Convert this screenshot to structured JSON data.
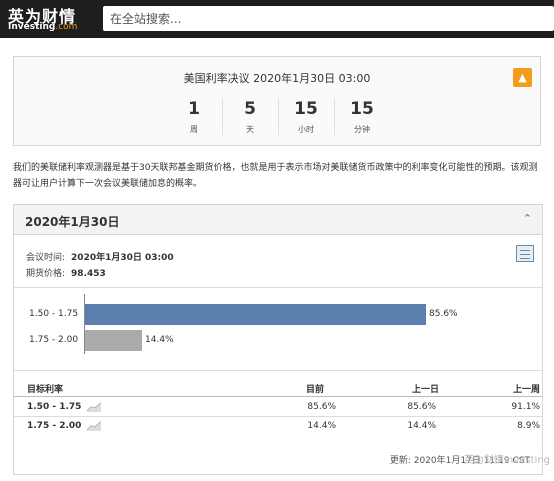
{
  "header": {
    "logo_cn": "英为财情",
    "logo_en": "Investing",
    "logo_suffix": ".com",
    "search_placeholder": "在全站搜索..."
  },
  "countdown": {
    "title": "美国利率决议 2020年1月30日 03:00",
    "alert_icon": "alert-bell-icon",
    "units": [
      {
        "value": "1",
        "label": "周"
      },
      {
        "value": "5",
        "label": "天"
      },
      {
        "value": "15",
        "label": "小时"
      },
      {
        "value": "15",
        "label": "分钟"
      }
    ]
  },
  "description": "我们的美联储利率观测器是基于30天联邦基金期货价格，也就是用于表示市场对美联储货币政策中的利率变化可能性的预期。该观测器可让用户计算下一次会议美联储加息的概率。",
  "meeting": {
    "title": "2020年1月30日",
    "time_label": "会议时间:",
    "time_value": "2020年1月30日 03:00",
    "price_label": "期货价格:",
    "price_value": "98.453",
    "updated": "更新: 2020年1月17日 11:19 CST"
  },
  "chart_data": {
    "type": "bar",
    "orientation": "horizontal",
    "categories": [
      "1.50 - 1.75",
      "1.75 - 2.00"
    ],
    "values": [
      85.6,
      14.4
    ],
    "value_labels": [
      "85.6%",
      "14.4%"
    ],
    "colors": [
      "#5b80b0",
      "#aaaaaa"
    ],
    "xlim": [
      0,
      100
    ]
  },
  "table": {
    "headers": [
      "目标利率",
      "目前",
      "上一日",
      "上一周"
    ],
    "rows": [
      {
        "rate": "1.50 - 1.75",
        "current": "85.6%",
        "prev_day": "85.6%",
        "prev_week": "91.1%"
      },
      {
        "rate": "1.75 - 2.00",
        "current": "14.4%",
        "prev_day": "14.4%",
        "prev_week": "8.9%"
      }
    ]
  },
  "watermark": "英为财情Investing"
}
